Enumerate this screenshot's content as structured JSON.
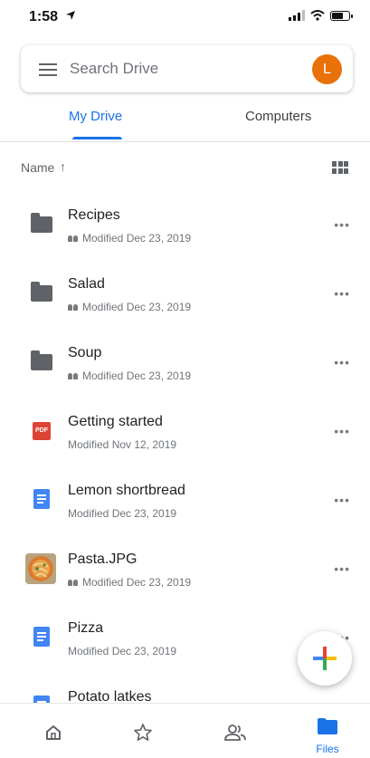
{
  "status_bar": {
    "time": "1:58"
  },
  "search": {
    "placeholder": "Search Drive",
    "avatar_letter": "L"
  },
  "tabs": [
    {
      "label": "My Drive",
      "selected": true
    },
    {
      "label": "Computers",
      "selected": false
    }
  ],
  "sort": {
    "label": "Name",
    "arrow": "↑"
  },
  "files": [
    {
      "name": "Recipes",
      "type": "folder",
      "shared": true,
      "meta": "Modified Dec 23, 2019"
    },
    {
      "name": "Salad",
      "type": "folder",
      "shared": true,
      "meta": "Modified Dec 23, 2019"
    },
    {
      "name": "Soup",
      "type": "folder",
      "shared": true,
      "meta": "Modified Dec 23, 2019"
    },
    {
      "name": "Getting started",
      "type": "pdf",
      "shared": false,
      "meta": "Modified Nov 12, 2019"
    },
    {
      "name": "Lemon shortbread",
      "type": "doc",
      "shared": false,
      "meta": "Modified Dec 23, 2019"
    },
    {
      "name": "Pasta.JPG",
      "type": "image",
      "shared": true,
      "meta": "Modified Dec 23, 2019"
    },
    {
      "name": "Pizza",
      "type": "doc",
      "shared": false,
      "meta": "Modified Dec 23, 2019"
    },
    {
      "name": "Potato latkes",
      "type": "doc",
      "shared": false,
      "meta": ""
    }
  ],
  "more_glyph": "•••",
  "pdf_label": "PDF",
  "bottom_nav": [
    {
      "icon": "home-icon",
      "label": ""
    },
    {
      "icon": "star-icon",
      "label": ""
    },
    {
      "icon": "shared-people-icon",
      "label": ""
    },
    {
      "icon": "files-folder-icon",
      "label": "Files",
      "selected": true
    }
  ],
  "colors": {
    "accent": "#1a73e8",
    "avatar": "#e8710a",
    "pdf": "#db4437",
    "doc": "#4285f4"
  }
}
